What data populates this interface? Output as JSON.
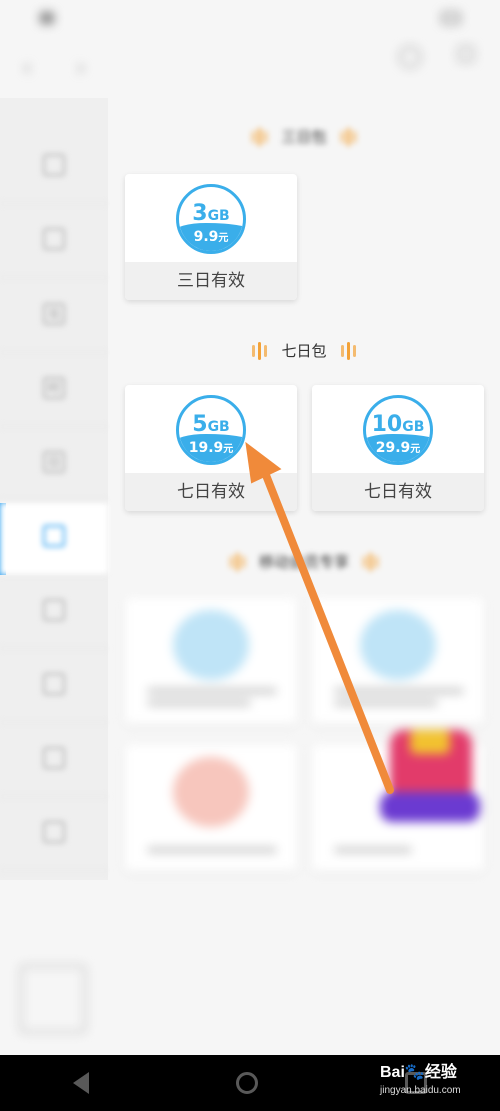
{
  "status_bar": {
    "left_text": "",
    "right_text": ""
  },
  "header": {
    "title": "",
    "icon1_label": "",
    "icon2_label": ""
  },
  "sidebar": {
    "top_label": "",
    "items": [
      {
        "label": "",
        "icon": "package-icon"
      },
      {
        "label": "",
        "icon": "vip-icon"
      },
      {
        "label": "",
        "icon": "points-icon",
        "glyph": "兑"
      },
      {
        "label": "",
        "icon": "clock-icon",
        "glyph": "时"
      },
      {
        "label": "",
        "icon": "calendar-icon",
        "glyph": "日"
      },
      {
        "label": "",
        "icon": "week-icon",
        "glyph": "",
        "active": true
      },
      {
        "label": "",
        "icon": "month-icon"
      },
      {
        "label": "",
        "icon": "extra-icon"
      },
      {
        "label": "",
        "icon": "more-icon"
      },
      {
        "label": "",
        "icon": "other-icon"
      }
    ],
    "bottom_box_text": ""
  },
  "sections": [
    {
      "title": "三日包"
    },
    {
      "title": "七日包"
    },
    {
      "title": "移动会员专享"
    }
  ],
  "three_day_cards": [
    {
      "gb": "3",
      "unit": "GB",
      "price": "9.9",
      "currency": "元",
      "footer": "三日有效"
    }
  ],
  "seven_day_cards": [
    {
      "gb": "5",
      "unit": "GB",
      "price": "19.9",
      "currency": "元",
      "footer": "七日有效"
    },
    {
      "gb": "10",
      "unit": "GB",
      "price": "29.9",
      "currency": "元",
      "footer": "七日有效"
    }
  ],
  "watermark": {
    "brand": "Bai",
    "brand_suffix": "经验",
    "domain": "jingyan.baidu.com"
  },
  "colors": {
    "accent": "#2ea1f0",
    "badge": "#3aaeea",
    "arrow": "#f08a3a",
    "section_deco": "#f3a238"
  }
}
